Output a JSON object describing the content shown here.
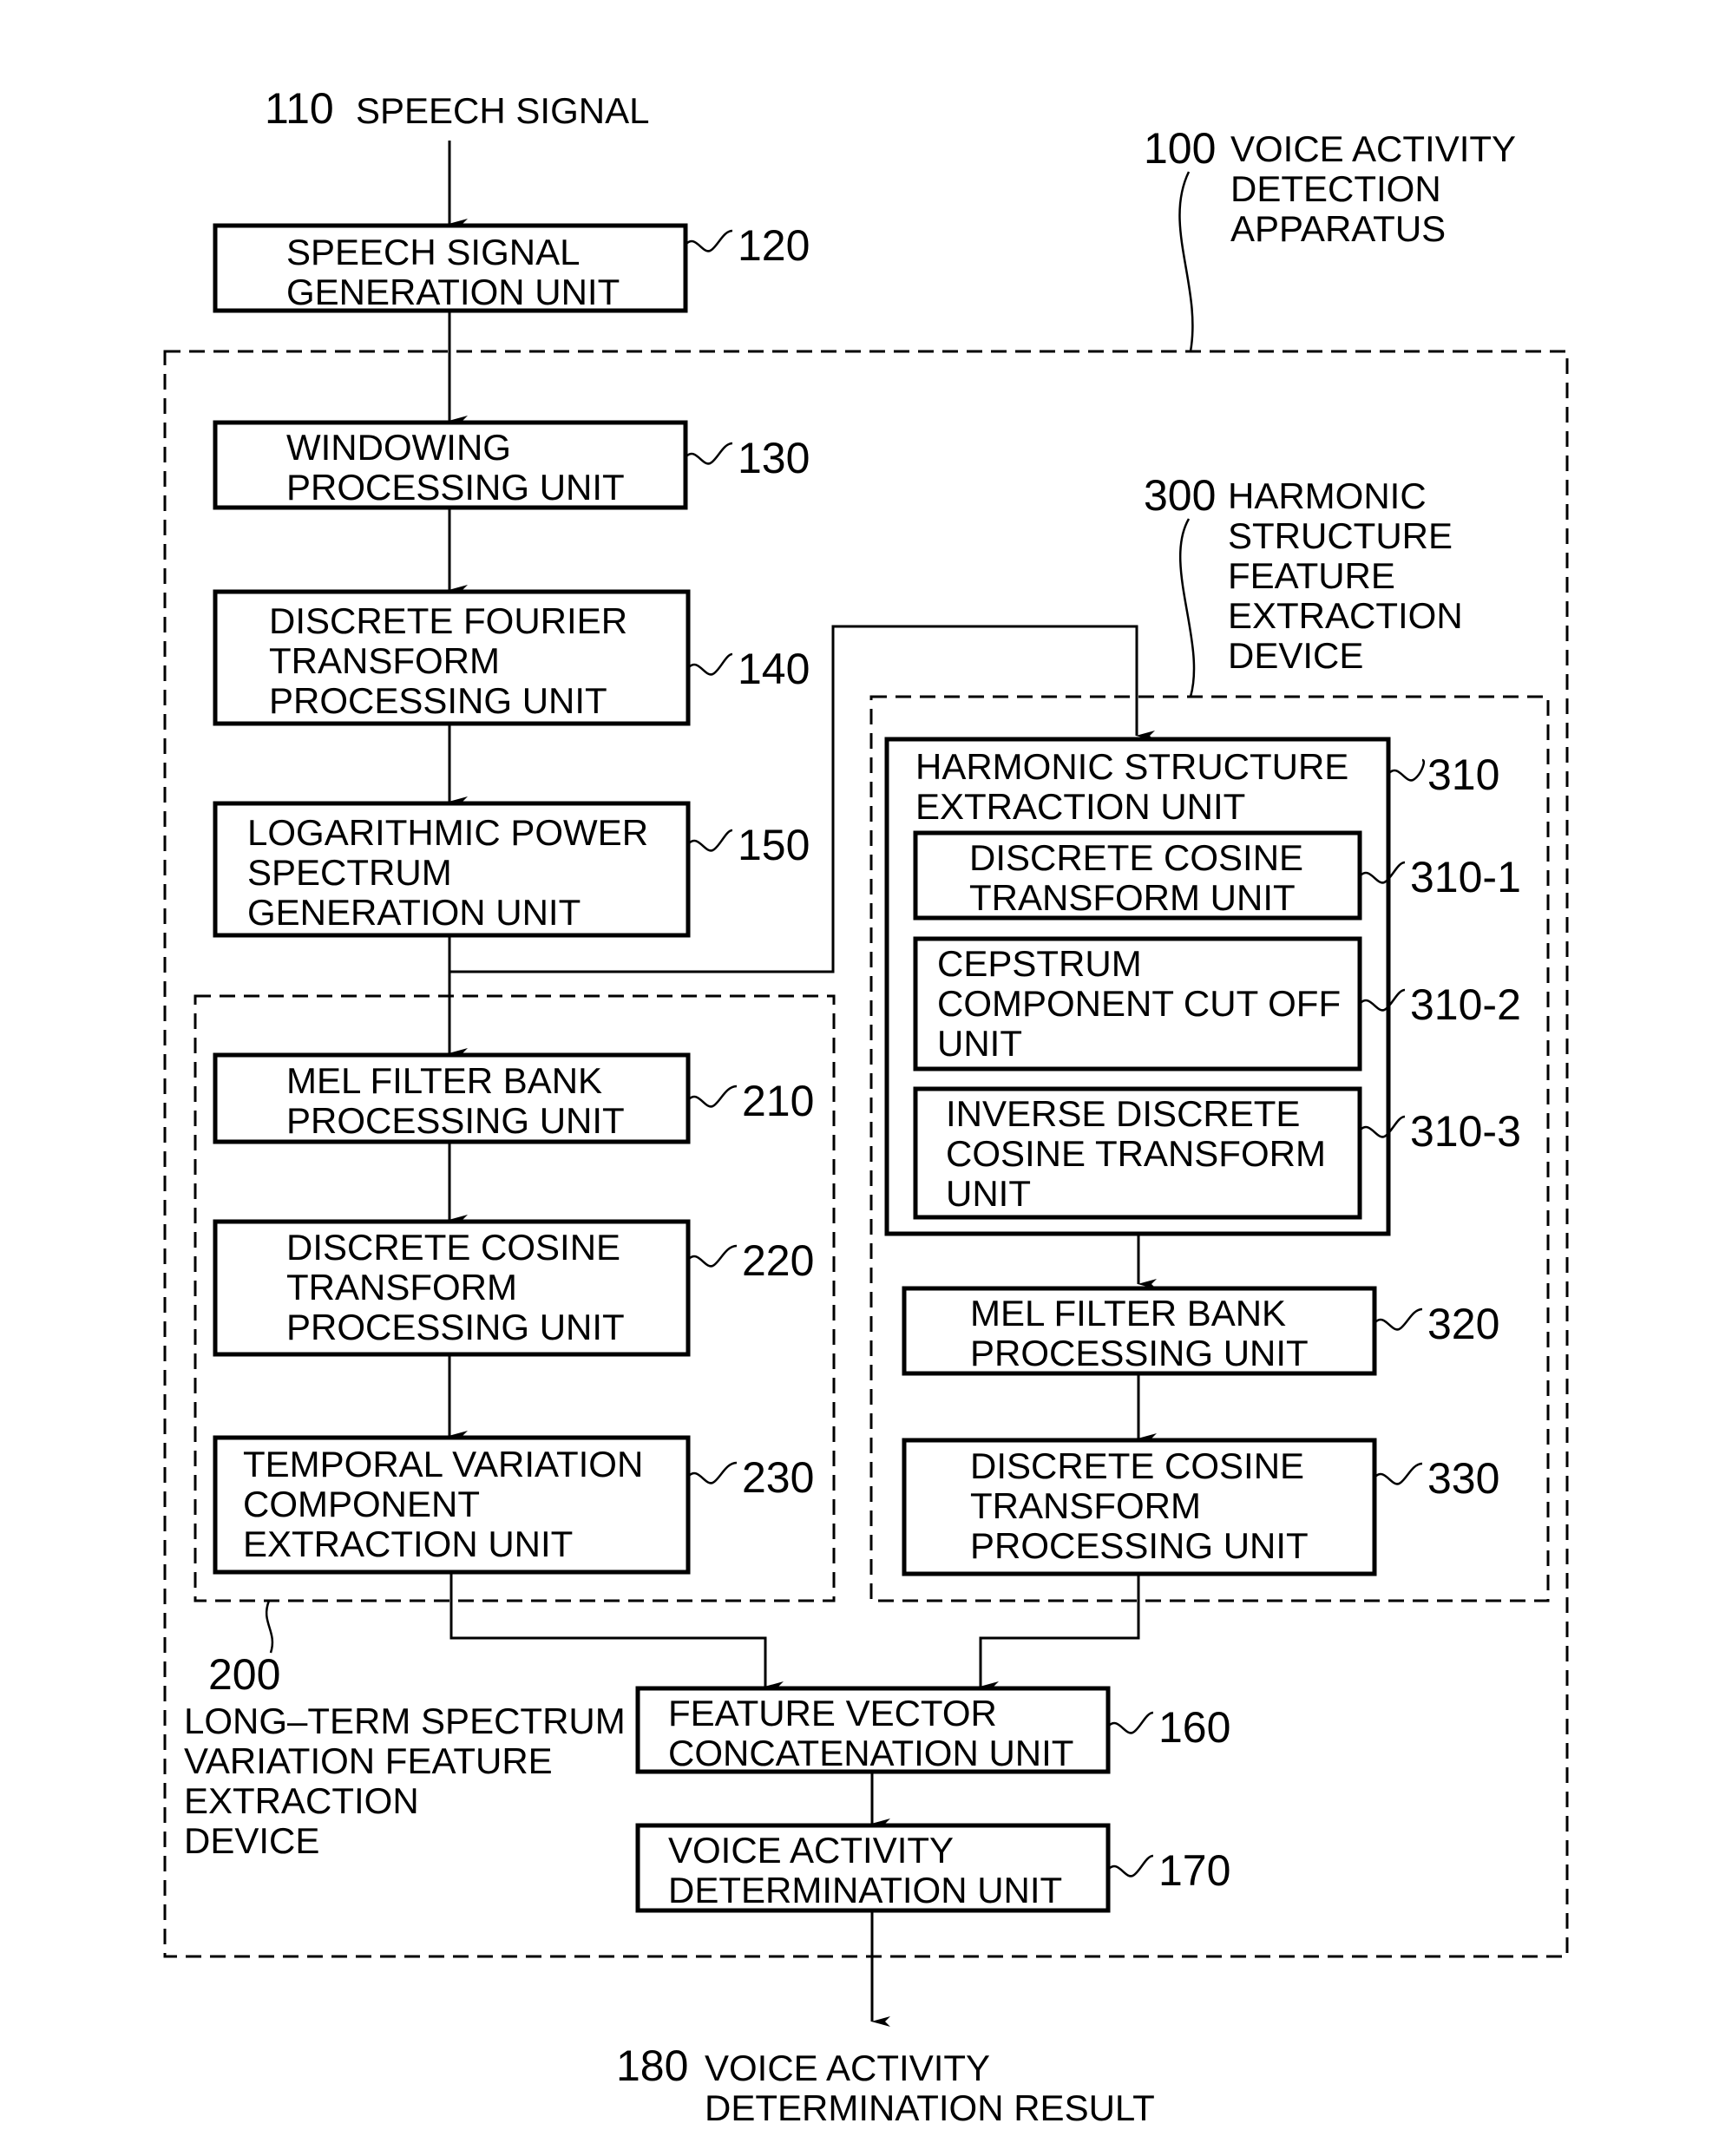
{
  "inputs": {
    "speech_signal": {
      "ref": "110",
      "label": "SPEECH SIGNAL"
    }
  },
  "outputs": {
    "result": {
      "ref": "180",
      "lines": [
        "VOICE ACTIVITY",
        "DETERMINATION RESULT"
      ]
    }
  },
  "groups": {
    "apparatus": {
      "ref": "100",
      "lines": [
        "VOICE ACTIVITY",
        "DETECTION",
        "APPARATUS"
      ]
    },
    "long_term": {
      "ref": "200",
      "lines": [
        "LONG–TERM SPECTRUM",
        "VARIATION FEATURE",
        "EXTRACTION",
        "DEVICE"
      ]
    },
    "harmonic": {
      "ref": "300",
      "lines": [
        "HARMONIC",
        "STRUCTURE",
        "FEATURE",
        "EXTRACTION",
        "DEVICE"
      ]
    }
  },
  "blocks": {
    "b120": {
      "ref": "120",
      "lines": [
        "SPEECH SIGNAL",
        "GENERATION UNIT"
      ]
    },
    "b130": {
      "ref": "130",
      "lines": [
        "WINDOWING",
        "PROCESSING UNIT"
      ]
    },
    "b140": {
      "ref": "140",
      "lines": [
        "DISCRETE FOURIER",
        "TRANSFORM",
        "PROCESSING UNIT"
      ]
    },
    "b150": {
      "ref": "150",
      "lines": [
        "LOGARITHMIC POWER",
        "SPECTRUM",
        "GENERATION UNIT"
      ]
    },
    "b210": {
      "ref": "210",
      "lines": [
        "MEL FILTER BANK",
        "PROCESSING UNIT"
      ]
    },
    "b220": {
      "ref": "220",
      "lines": [
        "DISCRETE COSINE",
        "TRANSFORM",
        "PROCESSING UNIT"
      ]
    },
    "b230": {
      "ref": "230",
      "lines": [
        "TEMPORAL VARIATION",
        "COMPONENT",
        "EXTRACTION UNIT"
      ]
    },
    "b310": {
      "ref": "310",
      "lines": [
        "HARMONIC STRUCTURE",
        "EXTRACTION UNIT"
      ]
    },
    "b310_1": {
      "ref": "310-1",
      "lines": [
        "DISCRETE COSINE",
        "TRANSFORM UNIT"
      ]
    },
    "b310_2": {
      "ref": "310-2",
      "lines": [
        "CEPSTRUM",
        "COMPONENT CUT OFF",
        "UNIT"
      ]
    },
    "b310_3": {
      "ref": "310-3",
      "lines": [
        "INVERSE DISCRETE",
        "COSINE TRANSFORM",
        "UNIT"
      ]
    },
    "b320": {
      "ref": "320",
      "lines": [
        "MEL FILTER BANK",
        "PROCESSING UNIT"
      ]
    },
    "b330": {
      "ref": "330",
      "lines": [
        "DISCRETE COSINE",
        "TRANSFORM",
        "PROCESSING UNIT"
      ]
    },
    "b160": {
      "ref": "160",
      "lines": [
        "FEATURE VECTOR",
        "CONCATENATION UNIT"
      ]
    },
    "b170": {
      "ref": "170",
      "lines": [
        "VOICE ACTIVITY",
        "DETERMINATION UNIT"
      ]
    }
  }
}
